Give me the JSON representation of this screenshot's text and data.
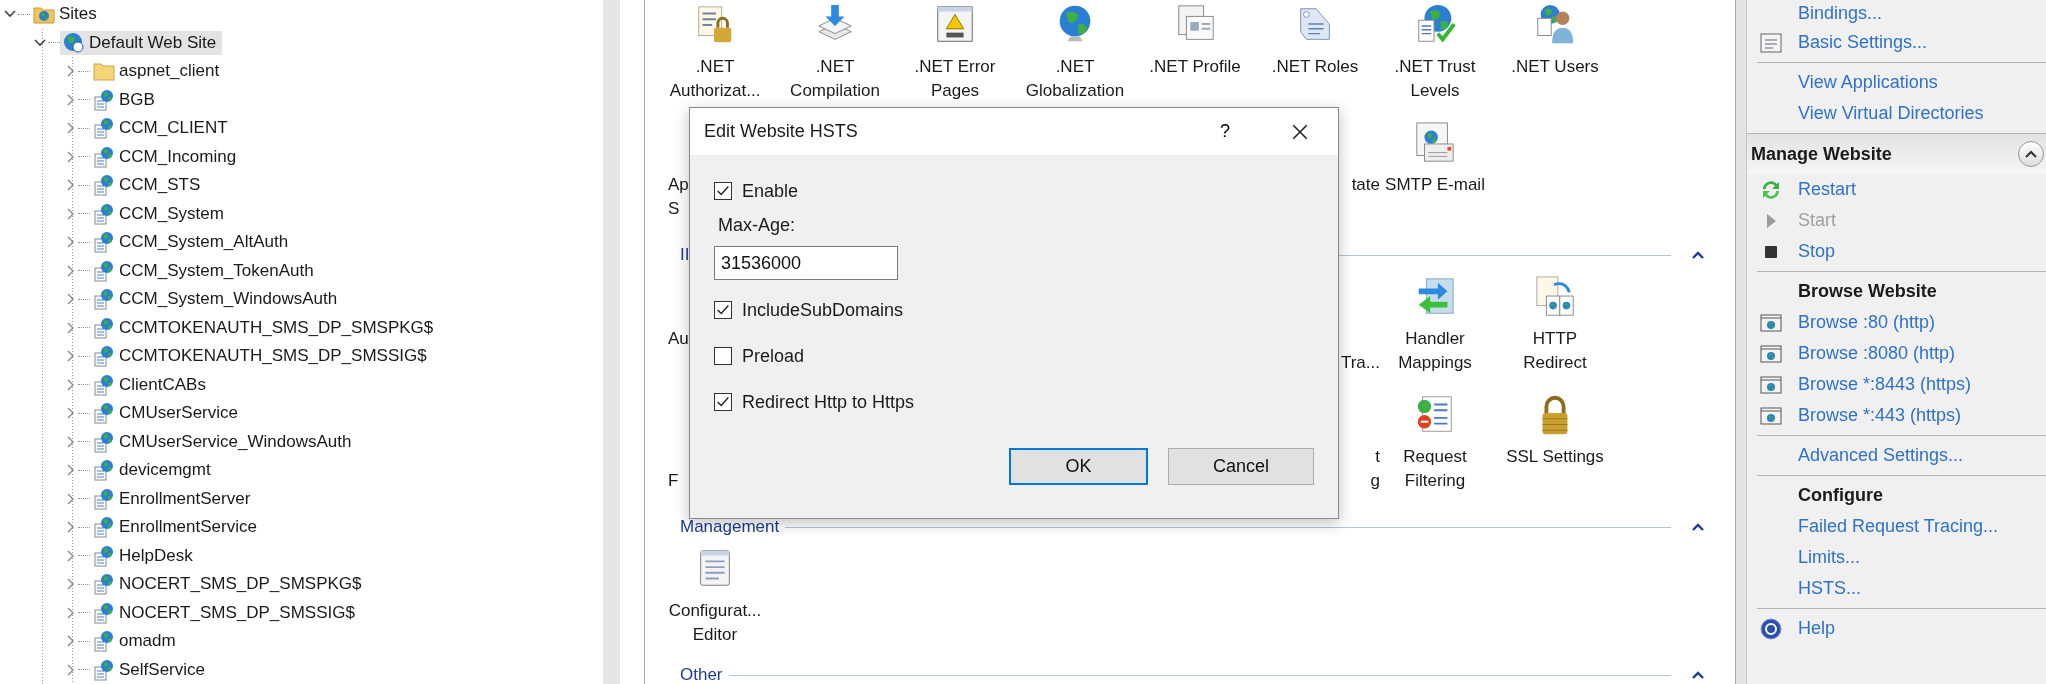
{
  "tree": [
    {
      "label": "Sites",
      "kind": "sites",
      "expanded": true,
      "selected": false,
      "children": [
        {
          "label": "Default Web Site",
          "kind": "website",
          "expanded": true,
          "selected": true,
          "children": [
            {
              "label": "aspnet_client",
              "kind": "folder",
              "expanded": false,
              "selected": false
            },
            {
              "label": "BGB",
              "kind": "app",
              "expanded": false,
              "selected": false
            },
            {
              "label": "CCM_CLIENT",
              "kind": "app",
              "expanded": false,
              "selected": false
            },
            {
              "label": "CCM_Incoming",
              "kind": "app",
              "expanded": false,
              "selected": false
            },
            {
              "label": "CCM_STS",
              "kind": "app",
              "expanded": false,
              "selected": false
            },
            {
              "label": "CCM_System",
              "kind": "app",
              "expanded": false,
              "selected": false
            },
            {
              "label": "CCM_System_AltAuth",
              "kind": "app",
              "expanded": false,
              "selected": false
            },
            {
              "label": "CCM_System_TokenAuth",
              "kind": "app",
              "expanded": false,
              "selected": false
            },
            {
              "label": "CCM_System_WindowsAuth",
              "kind": "app",
              "expanded": false,
              "selected": false
            },
            {
              "label": "CCMTOKENAUTH_SMS_DP_SMSPKG$",
              "kind": "app",
              "expanded": false,
              "selected": false
            },
            {
              "label": "CCMTOKENAUTH_SMS_DP_SMSSIG$",
              "kind": "app",
              "expanded": false,
              "selected": false
            },
            {
              "label": "ClientCABs",
              "kind": "app",
              "expanded": false,
              "selected": false
            },
            {
              "label": "CMUserService",
              "kind": "app",
              "expanded": false,
              "selected": false
            },
            {
              "label": "CMUserService_WindowsAuth",
              "kind": "app",
              "expanded": false,
              "selected": false
            },
            {
              "label": "devicemgmt",
              "kind": "app",
              "expanded": false,
              "selected": false
            },
            {
              "label": "EnrollmentServer",
              "kind": "app",
              "expanded": false,
              "selected": false
            },
            {
              "label": "EnrollmentService",
              "kind": "app",
              "expanded": false,
              "selected": false
            },
            {
              "label": "HelpDesk",
              "kind": "app",
              "expanded": false,
              "selected": false
            },
            {
              "label": "NOCERT_SMS_DP_SMSPKG$",
              "kind": "app",
              "expanded": false,
              "selected": false
            },
            {
              "label": "NOCERT_SMS_DP_SMSSIG$",
              "kind": "app",
              "expanded": false,
              "selected": false
            },
            {
              "label": "omadm",
              "kind": "app",
              "expanded": false,
              "selected": false
            },
            {
              "label": "SelfService",
              "kind": "app",
              "expanded": false,
              "selected": false
            }
          ]
        }
      ]
    }
  ],
  "features": [
    {
      "kind": "row",
      "items": [
        {
          "label": ".NET Authorizat...",
          "kind": "lock-list"
        },
        {
          "label": ".NET Compilation",
          "kind": "stack"
        },
        {
          "label": ".NET Error Pages",
          "kind": "error-page"
        },
        {
          "label": ".NET Globalization",
          "kind": "globe"
        },
        {
          "label": ".NET Profile",
          "kind": "profile"
        },
        {
          "label": ".NET Roles",
          "kind": "tag"
        },
        {
          "label": ".NET Trust Levels",
          "kind": "trust"
        },
        {
          "label": ".NET Users",
          "kind": "user"
        }
      ]
    },
    {
      "kind": "row",
      "left": [
        {
          "text": "Ap",
          "kind": "upper"
        },
        {
          "text": "S",
          "kind": "lower"
        }
      ],
      "right": [
        {
          "text": "tate",
          "kind": "upper"
        }
      ],
      "items": [
        {
          "label": "SMTP E-mail",
          "kind": "mail"
        }
      ]
    },
    {
      "kind": "header",
      "title": "II",
      "expanded": true
    },
    {
      "kind": "row",
      "left": [
        {
          "text": "Au",
          "kind": "upper"
        }
      ],
      "right": [
        {
          "text": "Tra...",
          "kind": "lower"
        }
      ],
      "items": [
        {
          "label": "Handler Mappings",
          "kind": "handler"
        },
        {
          "label": "HTTP Redirect",
          "kind": "redirect"
        }
      ]
    },
    {
      "kind": "row",
      "left": [
        {
          "text": "F",
          "kind": "lower"
        }
      ],
      "right": [
        {
          "text": "t",
          "kind": "upper"
        },
        {
          "text": "g",
          "kind": "lower"
        }
      ],
      "items": [
        {
          "label": "Request Filtering",
          "kind": "filter"
        },
        {
          "label": "SSL Settings",
          "kind": "padlock"
        }
      ]
    },
    {
      "kind": "header",
      "title": "Management",
      "expanded": true
    },
    {
      "kind": "row",
      "items": [
        {
          "label": "Configurat... Editor",
          "kind": "config"
        }
      ]
    },
    {
      "kind": "header",
      "title": "Other",
      "expanded": true
    }
  ],
  "dialog": {
    "title": "Edit Website HSTS",
    "help_button": "?",
    "options": [
      {
        "kind": "checkbox",
        "label": "Enable",
        "checked": true
      },
      {
        "kind": "field",
        "label": "Max-Age:",
        "value": "31536000"
      },
      {
        "kind": "checkbox",
        "label": "IncludeSubDomains",
        "checked": true
      },
      {
        "kind": "checkbox",
        "label": "Preload",
        "checked": false
      },
      {
        "kind": "checkbox",
        "label": "Redirect Http to Https",
        "checked": true
      }
    ],
    "buttons": [
      {
        "label": "OK",
        "default": true
      },
      {
        "label": "Cancel",
        "default": false
      }
    ]
  },
  "actions": [
    {
      "items": [
        {
          "kind": "link",
          "label": "Bindings...",
          "disabled": false
        },
        {
          "kind": "settings",
          "label": "Basic Settings...",
          "disabled": false
        }
      ]
    },
    {
      "items": [
        {
          "kind": "link",
          "label": "View Applications",
          "disabled": false
        },
        {
          "kind": "link",
          "label": "View Virtual Directories",
          "disabled": false
        }
      ]
    },
    {
      "section": {
        "title": "Manage Website",
        "expanded": true
      },
      "items": [
        {
          "kind": "restart",
          "label": "Restart",
          "disabled": false
        },
        {
          "kind": "start",
          "label": "Start",
          "disabled": true
        },
        {
          "kind": "stop",
          "label": "Stop",
          "disabled": false
        }
      ]
    },
    {
      "items": [
        {
          "kind": "heading",
          "label": "Browse Website"
        },
        {
          "kind": "browse",
          "label": "Browse :80 (http)",
          "disabled": false
        },
        {
          "kind": "browse",
          "label": "Browse :8080 (http)",
          "disabled": false
        },
        {
          "kind": "browse",
          "label": "Browse *:8443 (https)",
          "disabled": false
        },
        {
          "kind": "browse",
          "label": "Browse *:443 (https)",
          "disabled": false
        }
      ]
    },
    {
      "items": [
        {
          "kind": "link",
          "label": "Advanced Settings...",
          "disabled": false
        }
      ]
    },
    {
      "items": [
        {
          "kind": "heading",
          "label": "Configure"
        },
        {
          "kind": "link",
          "label": "Failed Request Tracing...",
          "disabled": false
        },
        {
          "kind": "link",
          "label": "Limits...",
          "disabled": false
        },
        {
          "kind": "link",
          "label": "HSTS...",
          "disabled": false
        }
      ]
    },
    {
      "items": [
        {
          "kind": "help",
          "label": "Help",
          "disabled": false
        }
      ]
    }
  ]
}
